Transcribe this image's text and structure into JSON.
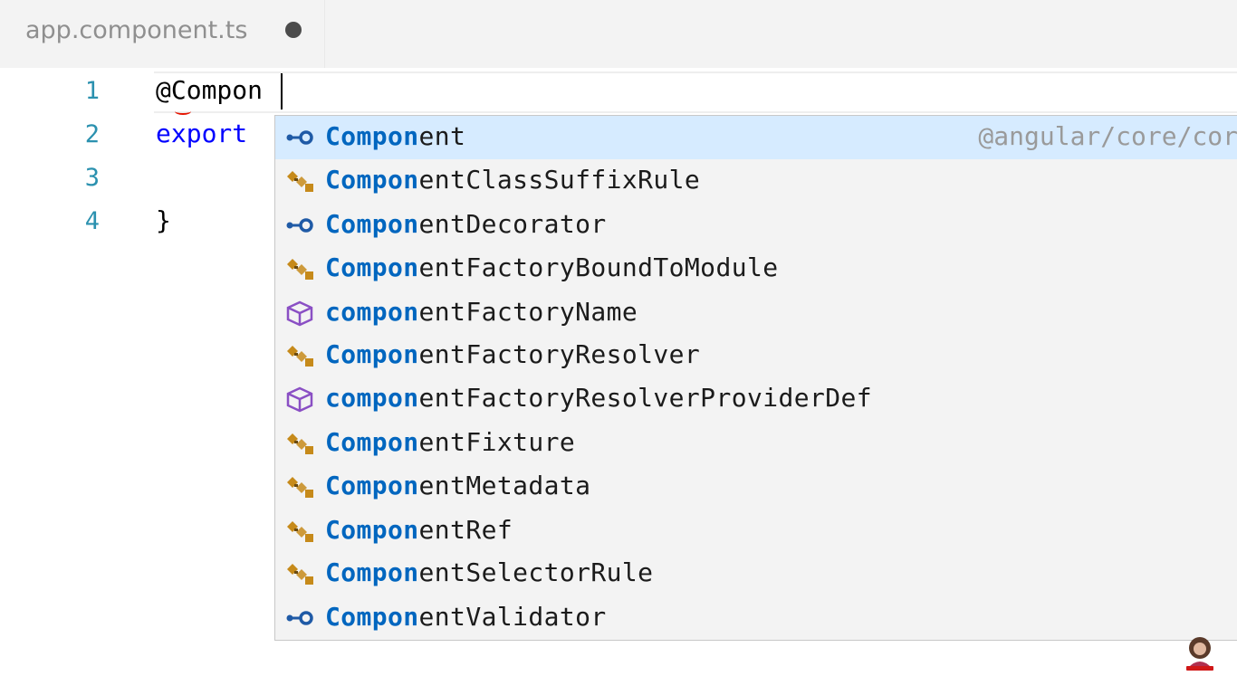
{
  "tab": {
    "title": "app.component.ts",
    "dirty": true
  },
  "editor": {
    "lines": [
      {
        "number": "1",
        "text": "@Compon"
      },
      {
        "number": "2",
        "text": "export"
      },
      {
        "number": "3",
        "text": ""
      },
      {
        "number": "4",
        "text": "}"
      }
    ]
  },
  "suggest": {
    "typed_prefix": "Compon",
    "items": [
      {
        "match": "Compon",
        "rest": "ent",
        "icon": "interface-icon",
        "detail": "@angular/core/cor"
      },
      {
        "match": "Compon",
        "rest": "entClassSuffixRule",
        "icon": "class-icon"
      },
      {
        "match": "Compon",
        "rest": "entDecorator",
        "icon": "interface-icon"
      },
      {
        "match": "Compon",
        "rest": "entFactoryBoundToModule",
        "icon": "class-icon"
      },
      {
        "match": "compon",
        "rest": "entFactoryName",
        "icon": "variable-icon"
      },
      {
        "match": "Compon",
        "rest": "entFactoryResolver",
        "icon": "class-icon"
      },
      {
        "match": "compon",
        "rest": "entFactoryResolverProviderDef",
        "icon": "variable-icon"
      },
      {
        "match": "Compon",
        "rest": "entFixture",
        "icon": "class-icon"
      },
      {
        "match": "Compon",
        "rest": "entMetadata",
        "icon": "class-icon"
      },
      {
        "match": "Compon",
        "rest": "entRef",
        "icon": "class-icon"
      },
      {
        "match": "Compon",
        "rest": "entSelectorRule",
        "icon": "class-icon"
      },
      {
        "match": "Compon",
        "rest": "entValidator",
        "icon": "interface-icon"
      }
    ],
    "selected_index": 0
  },
  "colors": {
    "line_number": "#2b91af",
    "keyword": "#0000ff",
    "match_highlight": "#0066bf",
    "selected_row": "#d6ebff",
    "class_icon": "#c68a1a",
    "interface_icon": "#1f5aa6",
    "variable_icon": "#8a4fc4"
  }
}
